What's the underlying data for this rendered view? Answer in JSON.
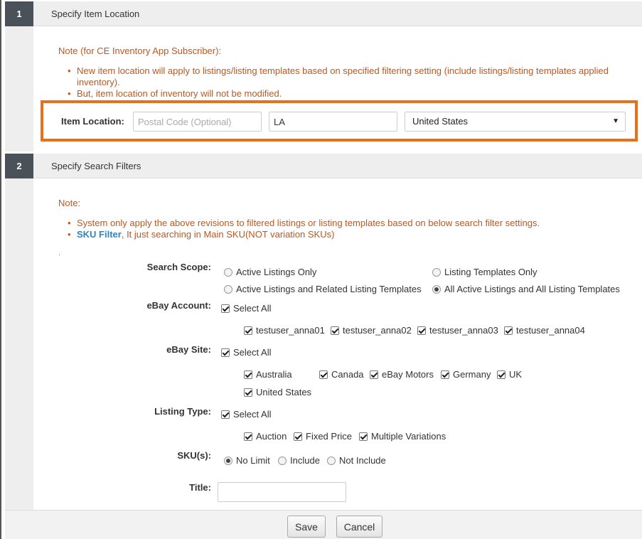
{
  "step1": {
    "number": "1",
    "title": "Specify Item Location",
    "note_heading": "Note (for CE Inventory App Subscriber):",
    "note_items": [
      "New item location will apply to listings/listing templates based on specified filtering setting (include listings/listing templates applied inventory).",
      "But, item location of inventory will not be modified."
    ],
    "item_location_label": "Item Location:",
    "postal_code_placeholder": "Postal Code (Optional)",
    "postal_code_value": "",
    "city_value": "LA",
    "country_value": "United States"
  },
  "step2": {
    "number": "2",
    "title": "Specify Search Filters",
    "note_heading": "Note:",
    "note_item1": "System only apply the above revisions to filtered listings or listing templates based on below search filter settings.",
    "note_item2_link": "SKU Filter",
    "note_item2_rest": ", It just searching in Main SKU(NOT variation SKUs)",
    "dot": "."
  },
  "filters": {
    "search_scope_label": "Search Scope:",
    "scope_options": [
      {
        "label": "Active Listings Only",
        "checked": false
      },
      {
        "label": "Listing Templates Only",
        "checked": false
      },
      {
        "label": "Active Listings and Related Listing Templates",
        "checked": false
      },
      {
        "label": "All Active Listings and All Listing Templates",
        "checked": true
      }
    ],
    "ebay_account_label": "eBay Account:",
    "account_select_all": "Select All",
    "accounts": [
      "testuser_anna01",
      "testuser_anna02",
      "testuser_anna03",
      "testuser_anna04"
    ],
    "ebay_site_label": "eBay Site:",
    "site_select_all": "Select All",
    "sites": [
      "Australia",
      "Canada",
      "eBay Motors",
      "Germany",
      "UK",
      "United States"
    ],
    "listing_type_label": "Listing Type:",
    "type_select_all": "Select All",
    "types": [
      "Auction",
      "Fixed Price",
      "Multiple Variations"
    ],
    "skus_label": "SKU(s):",
    "sku_options": [
      {
        "label": "No Limit",
        "checked": true
      },
      {
        "label": "Include",
        "checked": false
      },
      {
        "label": "Not Include",
        "checked": false
      }
    ],
    "title_label": "Title:",
    "title_value": ""
  },
  "footer": {
    "save_label": "Save",
    "cancel_label": "Cancel"
  },
  "colors": {
    "highlight": "#e8701c",
    "note_text": "#c0571c",
    "link": "#2a86c8",
    "step_badge": "#4a5159"
  }
}
